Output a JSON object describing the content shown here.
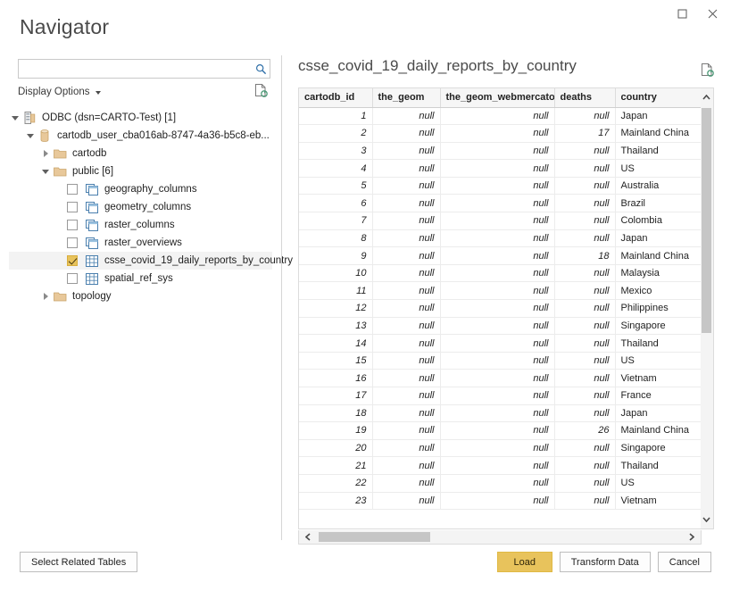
{
  "window": {
    "title": "Navigator",
    "controls": [
      {
        "name": "maximize-button",
        "icon": "maximize-icon"
      },
      {
        "name": "close-button",
        "icon": "close-icon"
      }
    ]
  },
  "search": {
    "value": "",
    "placeholder": "",
    "icon": "search-icon"
  },
  "display_options": {
    "label": "Display Options",
    "caret_icon": "chevron-down-icon"
  },
  "refresh_left": {
    "icon": "refresh-document-icon"
  },
  "tree": {
    "items": [
      {
        "label": "ODBC (dsn=CARTO-Test) [1]",
        "level": 0,
        "twisty": "open",
        "icon": "server-icon",
        "checkbox": "none",
        "selected": false
      },
      {
        "label": "cartodb_user_cba016ab-8747-4a36-b5c8-eb...",
        "level": 1,
        "twisty": "open",
        "icon": "database-icon",
        "checkbox": "none",
        "selected": false
      },
      {
        "label": "cartodb",
        "level": 2,
        "twisty": "closed",
        "icon": "folder-icon",
        "checkbox": "none",
        "selected": false
      },
      {
        "label": "public [6]",
        "level": 2,
        "twisty": "open",
        "icon": "folder-icon",
        "checkbox": "none",
        "selected": false
      },
      {
        "label": "geography_columns",
        "level": 3,
        "twisty": "none",
        "icon": "view-icon",
        "checkbox": "unchecked",
        "selected": false
      },
      {
        "label": "geometry_columns",
        "level": 3,
        "twisty": "none",
        "icon": "view-icon",
        "checkbox": "unchecked",
        "selected": false
      },
      {
        "label": "raster_columns",
        "level": 3,
        "twisty": "none",
        "icon": "view-icon",
        "checkbox": "unchecked",
        "selected": false
      },
      {
        "label": "raster_overviews",
        "level": 3,
        "twisty": "none",
        "icon": "view-icon",
        "checkbox": "unchecked",
        "selected": false
      },
      {
        "label": "csse_covid_19_daily_reports_by_country",
        "level": 3,
        "twisty": "none",
        "icon": "table-icon",
        "checkbox": "checked",
        "selected": true
      },
      {
        "label": "spatial_ref_sys",
        "level": 3,
        "twisty": "none",
        "icon": "table-icon",
        "checkbox": "unchecked",
        "selected": false
      },
      {
        "label": "topology",
        "level": 2,
        "twisty": "closed",
        "icon": "folder-icon",
        "checkbox": "none",
        "selected": false
      }
    ]
  },
  "preview": {
    "title": "csse_covid_19_daily_reports_by_country",
    "refresh_icon": "refresh-document-icon",
    "columns": [
      "cartodb_id",
      "the_geom",
      "the_geom_webmercator",
      "deaths",
      "country"
    ],
    "rows": [
      [
        "1",
        "null",
        "null",
        "null",
        "Japan"
      ],
      [
        "2",
        "null",
        "null",
        "17",
        "Mainland China"
      ],
      [
        "3",
        "null",
        "null",
        "null",
        "Thailand"
      ],
      [
        "4",
        "null",
        "null",
        "null",
        "US"
      ],
      [
        "5",
        "null",
        "null",
        "null",
        "Australia"
      ],
      [
        "6",
        "null",
        "null",
        "null",
        "Brazil"
      ],
      [
        "7",
        "null",
        "null",
        "null",
        "Colombia"
      ],
      [
        "8",
        "null",
        "null",
        "null",
        "Japan"
      ],
      [
        "9",
        "null",
        "null",
        "18",
        "Mainland China"
      ],
      [
        "10",
        "null",
        "null",
        "null",
        "Malaysia"
      ],
      [
        "11",
        "null",
        "null",
        "null",
        "Mexico"
      ],
      [
        "12",
        "null",
        "null",
        "null",
        "Philippines"
      ],
      [
        "13",
        "null",
        "null",
        "null",
        "Singapore"
      ],
      [
        "14",
        "null",
        "null",
        "null",
        "Thailand"
      ],
      [
        "15",
        "null",
        "null",
        "null",
        "US"
      ],
      [
        "16",
        "null",
        "null",
        "null",
        "Vietnam"
      ],
      [
        "17",
        "null",
        "null",
        "null",
        "France"
      ],
      [
        "18",
        "null",
        "null",
        "null",
        "Japan"
      ],
      [
        "19",
        "null",
        "null",
        "26",
        "Mainland China"
      ],
      [
        "20",
        "null",
        "null",
        "null",
        "Singapore"
      ],
      [
        "21",
        "null",
        "null",
        "null",
        "Thailand"
      ],
      [
        "22",
        "null",
        "null",
        "null",
        "US"
      ],
      [
        "23",
        "null",
        "null",
        "null",
        "Vietnam"
      ]
    ]
  },
  "scrollbars": {
    "vertical": {
      "up_icon": "chevron-up-icon",
      "down_icon": "chevron-down-icon"
    },
    "horizontal": {
      "left_icon": "chevron-left-icon",
      "right_icon": "chevron-right-icon"
    }
  },
  "footer": {
    "select_related_tables": "Select Related Tables",
    "load": "Load",
    "transform_data": "Transform Data",
    "cancel": "Cancel"
  },
  "colors": {
    "accent": "#e8c35c",
    "folder": "#e8c89a",
    "divider": "#d6d6d6",
    "header_bg": "#f6f6f6",
    "selection": "#f3f3f3"
  }
}
